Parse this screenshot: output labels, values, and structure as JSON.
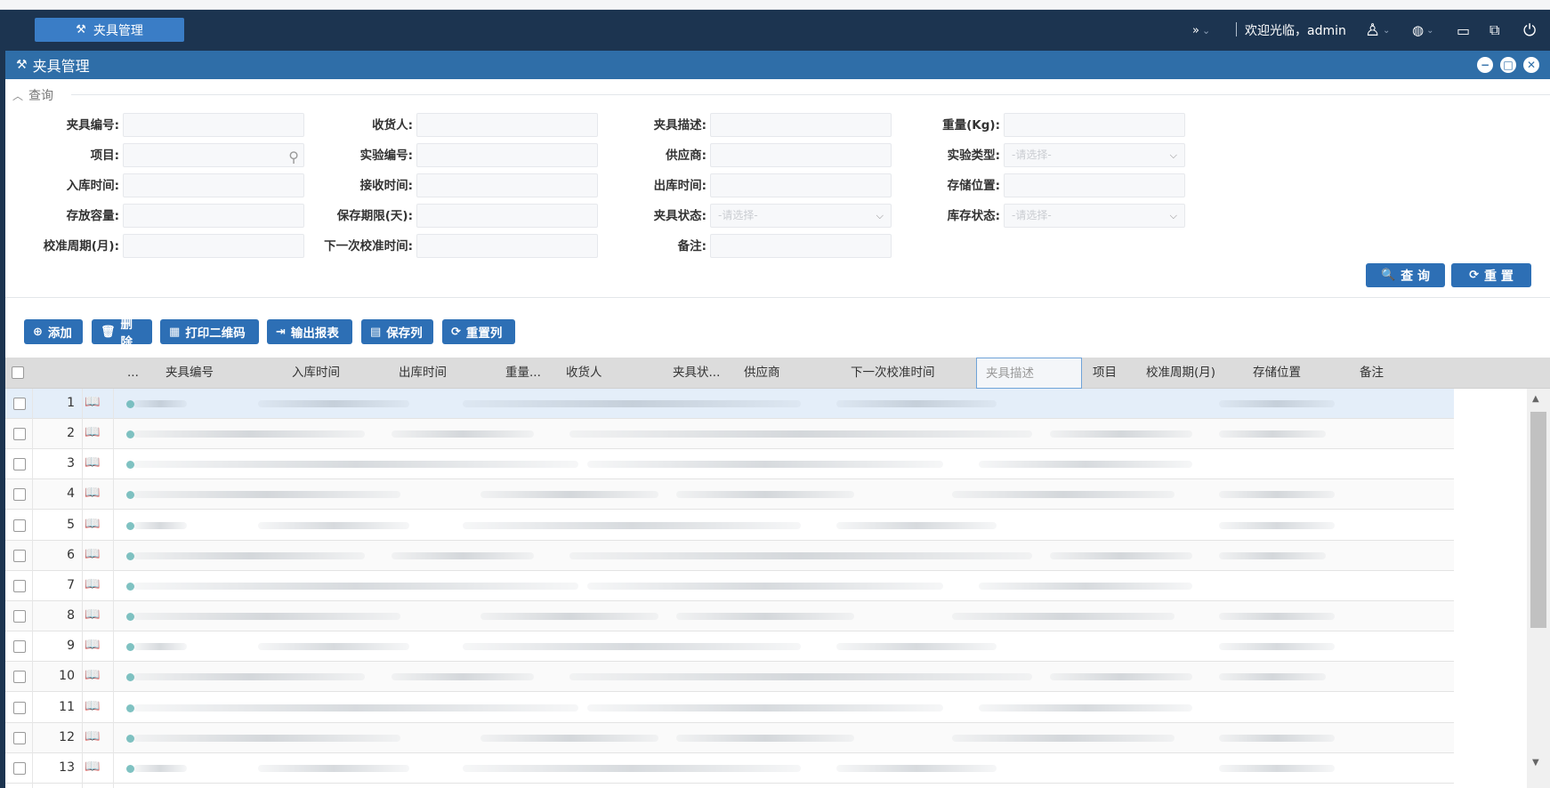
{
  "app": {
    "module_button": "夹具管理",
    "welcome": "欢迎光临，admin"
  },
  "window": {
    "title": "夹具管理"
  },
  "query": {
    "legend": "查询",
    "fields": [
      {
        "label": "夹具编号:"
      },
      {
        "label": "收货人:"
      },
      {
        "label": "夹具描述:"
      },
      {
        "label": "重量(Kg):"
      },
      {
        "label": "项目:"
      },
      {
        "label": "实验编号:"
      },
      {
        "label": "供应商:"
      },
      {
        "label": "实验类型:",
        "placeholder": "-请选择-"
      },
      {
        "label": "入库时间:"
      },
      {
        "label": "接收时间:"
      },
      {
        "label": "出库时间:"
      },
      {
        "label": "存储位置:"
      },
      {
        "label": "存放容量:"
      },
      {
        "label": "保存期限(天):"
      },
      {
        "label": "夹具状态:",
        "placeholder": "-请选择-"
      },
      {
        "label": "库存状态:",
        "placeholder": "-请选择-"
      },
      {
        "label": "校准周期(月):"
      },
      {
        "label": "下一次校准时间:"
      },
      {
        "label": "备注:"
      }
    ],
    "search_button": "查 询",
    "reset_button": "重 置"
  },
  "toolbar": {
    "add": "添加",
    "delete": "删除",
    "print_qr": "打印二维码",
    "export": "输出报表",
    "save_cols": "保存列",
    "reset_cols": "重置列"
  },
  "grid": {
    "columns": [
      "...",
      "夹具编号",
      "入库时间",
      "出库时间",
      "重量...",
      "收货人",
      "夹具状...",
      "供应商",
      "下一次校准时间",
      "夹具描述",
      "项目",
      "校准周期(月)",
      "存储位置",
      "备注"
    ],
    "row_numbers": [
      "1",
      "2",
      "3",
      "4",
      "5",
      "6",
      "7",
      "8",
      "9",
      "10",
      "11",
      "12",
      "13"
    ],
    "selected_row": 1
  },
  "icons": [
    "module-icon",
    "double-chevron-icon",
    "user-icon",
    "globe-icon",
    "monitor-icon",
    "window-icon",
    "power-icon",
    "minimize-icon",
    "restore-icon",
    "close-icon",
    "search-icon",
    "book-icon"
  ],
  "colors": {
    "topbar": "#1c3450",
    "titlebar": "#2f6ea8",
    "button": "#2d6fb5"
  }
}
